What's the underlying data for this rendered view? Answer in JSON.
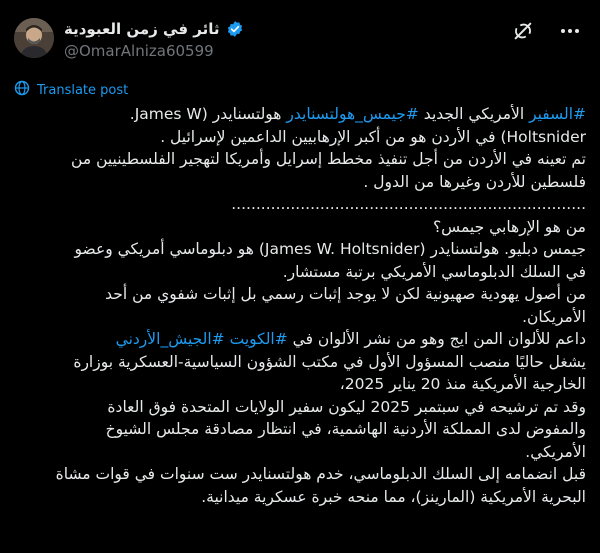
{
  "author": {
    "display_name": "ثائر في زمن العبودية",
    "handle": "@OmarAlniza60599",
    "verified": true
  },
  "actions": {
    "translate_label": "Translate post",
    "grok_icon": "grok-icon",
    "more_icon": "more-dots-icon"
  },
  "colors": {
    "background": "#000000",
    "text": "#e7e9ea",
    "accent": "#1d9bf0",
    "muted": "#71767b"
  },
  "post": {
    "l1_tag1": "#السفير",
    "l1_text1": " الأمريكي الجديد ",
    "l1_tag2": "#جيمس_هولتسنايدر",
    "l1_text2": " هولتسنايدر (James W.",
    "l2": "Holtsnider)  في الأردن هو من أكبر الإرهابيين الداعمين لإسرائيل .",
    "l3": "تم تعينه في الأردن من أجل تنفيذ مخطط إسرايل وأمريكا لتهجير الفلسطينيين من",
    "l4": "فلسطين للأردن وغيرها من الدول .",
    "l5": "........................................................................",
    "l6": "من هو الإرهابي جيمس؟",
    "l7": "جيمس دبليو. هولتسنايدر (James W. Holtsnider) هو دبلوماسي أمريكي وعضو",
    "l8": "في السلك الدبلوماسي الأمريكي برتبة مستشار.",
    "l9": "من أصول يهودية صهيونية لكن لا يوجد إثبات رسمي بل إثبات شفوي من أحد",
    "l10": "الأمريكان.",
    "l11_text": "داعم للألوان المن ايج وهو من نشر الألوان في ",
    "l11_tag1": "#الكويت",
    "l11_sp": " ",
    "l11_tag2": "#الجيش_الأردني",
    "l12": "يشغل حاليًا منصب المسؤول الأول في مكتب الشؤون السياسية-العسكرية بوزارة",
    "l13": "الخارجية الأمريكية منذ 20 يناير 2025،",
    "l14": "وقد تم ترشيحه في سبتمبر 2025 ليكون سفير الولايات المتحدة فوق العادة",
    "l15": "والمفوض لدى المملكة الأردنية الهاشمية، في انتظار مصادقة مجلس الشيوخ",
    "l16": "الأمريكي.",
    "l17": "قبل انضمامه إلى السلك الدبلوماسي، خدم هولتسنايدر ست سنوات في قوات مشاة",
    "l18": "البحرية الأمريكية (المارينز)، مما منحه خبرة عسكرية ميدانية."
  }
}
